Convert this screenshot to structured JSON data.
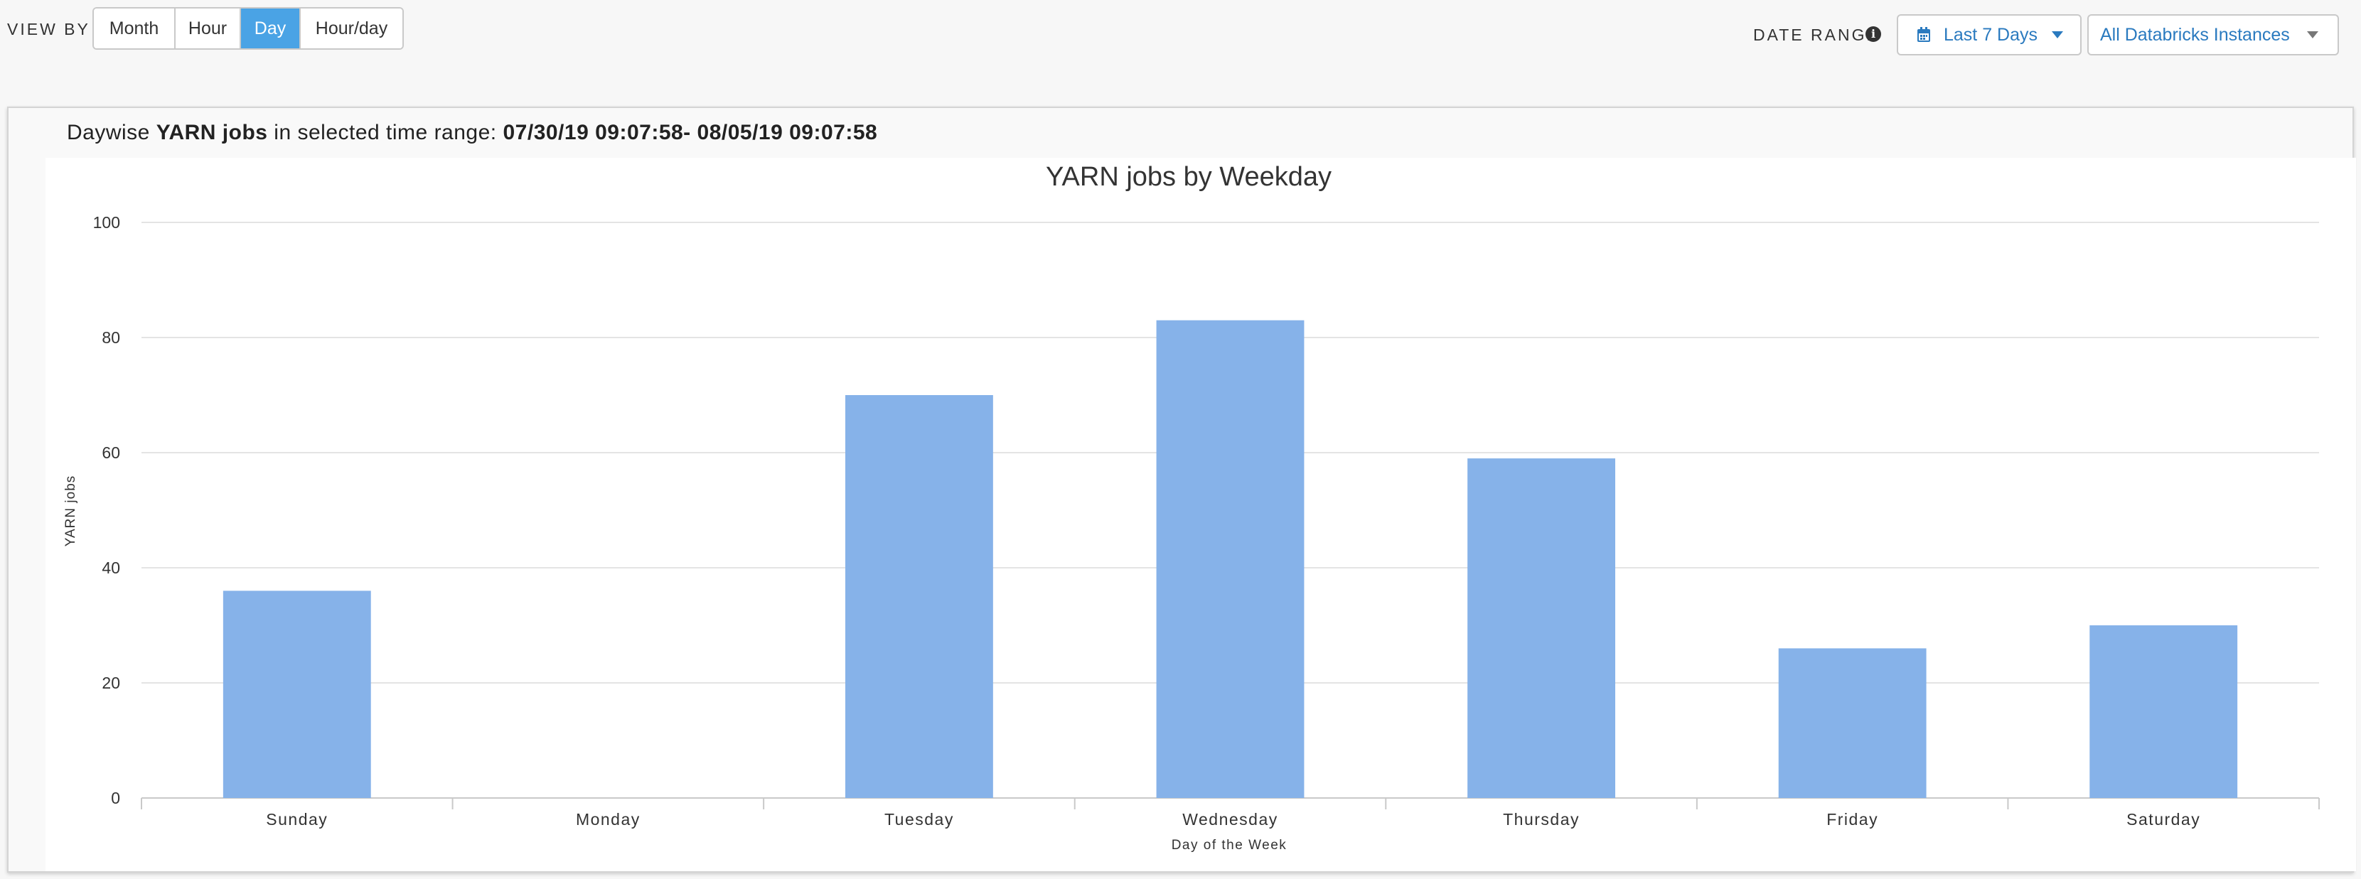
{
  "toolbar": {
    "view_by_label": "VIEW BY",
    "view_options": [
      "Month",
      "Hour",
      "Day",
      "Hour/day"
    ],
    "view_selected": "Day",
    "date_range_label": "DATE RANGE",
    "date_range_icon": "info-circle-icon",
    "date_range_value": "Last 7 Days",
    "instance_value": "All Databricks Instances"
  },
  "panel": {
    "header_prefix": "Daywise ",
    "header_bold": "YARN jobs",
    "header_middle": " in selected time range: ",
    "header_range": "07/30/19 09:07:58- 08/05/19 09:07:58"
  },
  "colors": {
    "accent": "#4aa3e5",
    "link": "#2a7abf",
    "bar": "#86b2e9"
  },
  "chart_data": {
    "type": "bar",
    "title": "YARN jobs by Weekday",
    "xlabel": "Day of the Week",
    "ylabel": "YARN jobs",
    "categories": [
      "Sunday",
      "Monday",
      "Tuesday",
      "Wednesday",
      "Thursday",
      "Friday",
      "Saturday"
    ],
    "values": [
      36,
      0,
      70,
      83,
      59,
      26,
      30
    ],
    "ylim": [
      0,
      100
    ],
    "yticks": [
      0,
      20,
      40,
      60,
      80,
      100
    ],
    "grid": true,
    "legend": "none"
  }
}
